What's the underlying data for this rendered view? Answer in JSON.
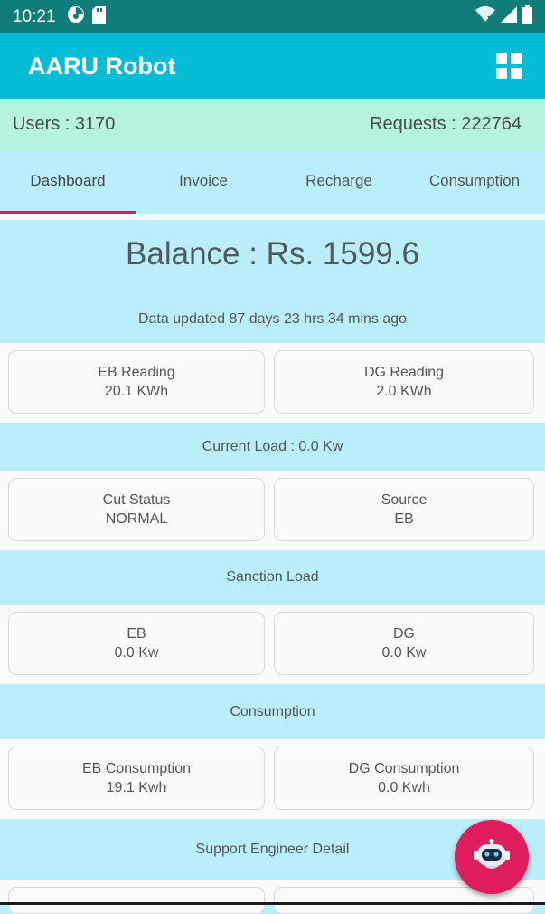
{
  "status_bar": {
    "time": "10:21",
    "icons": [
      "vpn-key-icon",
      "sd-card-icon",
      "wifi-icon",
      "signal-icon",
      "battery-icon"
    ]
  },
  "app_bar": {
    "title": "AARU Robot",
    "menu_icon": "grid-icon"
  },
  "stats": {
    "users": "Users : 3170",
    "requests": "Requests : 222764"
  },
  "tabs": [
    {
      "label": "Dashboard",
      "active": true
    },
    {
      "label": "Invoice",
      "active": false
    },
    {
      "label": "Recharge",
      "active": false
    },
    {
      "label": "Consumption",
      "active": false
    }
  ],
  "dashboard": {
    "balance": "Balance : Rs. 1599.6",
    "updated": "Data updated 87 days 23 hrs 34 mins  ago",
    "readings": {
      "eb": {
        "title": "EB Reading",
        "value": "20.1 KWh"
      },
      "dg": {
        "title": "DG Reading",
        "value": "2.0 KWh"
      }
    },
    "current_load": "Current Load : 0.0 Kw",
    "status": {
      "cut": {
        "title": "Cut Status",
        "value": "NORMAL"
      },
      "source": {
        "title": "Source",
        "value": "EB"
      }
    },
    "sanction_heading": "Sanction Load",
    "sanction": {
      "eb": {
        "title": "EB",
        "value": "0.0 Kw"
      },
      "dg": {
        "title": "DG",
        "value": "0.0 Kw"
      }
    },
    "consumption_heading": "Consumption",
    "consumption": {
      "eb": {
        "title": "EB Consumption",
        "value": "19.1 Kwh"
      },
      "dg": {
        "title": "DG Consumption",
        "value": "0.0 Kwh"
      }
    },
    "support_heading": "Support Engineer Detail"
  },
  "fab": {
    "icon": "robot-icon"
  },
  "colors": {
    "status_bar": "#107d79",
    "app_bar": "#04bcd6",
    "stats_bar": "#b6f3de",
    "panel": "#b9eefa",
    "tab_indicator": "#d81b60",
    "fab": "#e01d5f"
  }
}
